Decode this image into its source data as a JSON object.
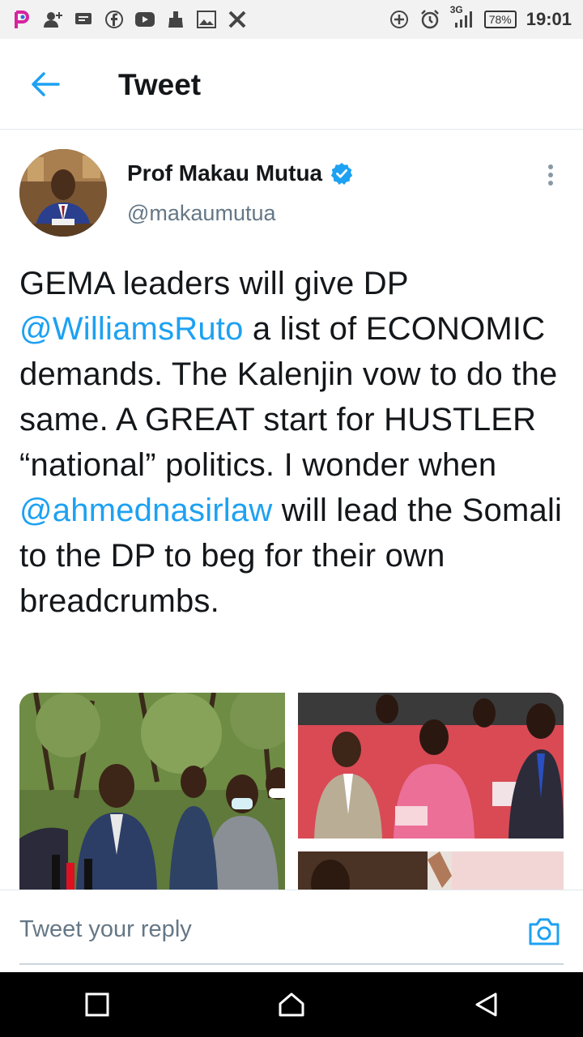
{
  "status_bar": {
    "time": "19:01",
    "battery": "78%",
    "network": "3G",
    "icons_left": [
      "picsart-icon",
      "add-contact-icon",
      "message-icon",
      "facebook-icon",
      "youtube-icon",
      "cleaner-icon",
      "image-icon",
      "x-icon"
    ],
    "icons_right": [
      "add-circle-icon",
      "alarm-icon",
      "signal-icon",
      "battery-icon"
    ]
  },
  "header": {
    "title": "Tweet"
  },
  "author": {
    "name": "Prof Makau Mutua",
    "handle": "@makaumutua",
    "verified": true
  },
  "tweet": {
    "segments": [
      {
        "text": "GEMA leaders will give DP ",
        "type": "text"
      },
      {
        "text": "@WilliamsRuto",
        "type": "mention"
      },
      {
        "text": " a list of ECONOMIC demands.  The Kalenjin vow to do the same.  A GREAT start for HUSTLER “national” politics.  I wonder when ",
        "type": "text"
      },
      {
        "text": "@ahmednasirlaw",
        "type": "mention"
      },
      {
        "text": " will lead the Somali to the DP to beg for their own breadcrumbs.",
        "type": "text"
      }
    ]
  },
  "reply": {
    "placeholder": "Tweet your reply"
  },
  "colors": {
    "accent": "#1da1f2",
    "text": "#14171a",
    "secondary": "#657786"
  }
}
